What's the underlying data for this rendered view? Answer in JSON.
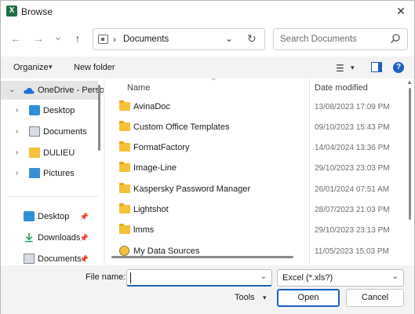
{
  "window": {
    "title": "Browse",
    "app_icon_glyph": "X",
    "close_glyph": "✕"
  },
  "nav": {
    "back_glyph": "←",
    "forward_glyph": "→",
    "recent_glyph": "⌄",
    "up_glyph": "↑",
    "address_sep": "›",
    "address": "Documents",
    "address_drop_glyph": "⌄",
    "refresh_glyph": "↻",
    "search_placeholder": "Search Documents"
  },
  "toolbar": {
    "organize": "Organize",
    "organize_caret": "▾",
    "new_folder": "New folder",
    "view_glyph": "☰",
    "view_caret": "▾",
    "help_glyph": "?"
  },
  "navpane": {
    "items": [
      {
        "label": "OneDrive - Perso",
        "chev": "⌄",
        "icon": "cloud-icon",
        "selected": true
      },
      {
        "label": "Desktop",
        "chev": "›",
        "icon": "desktop-icon"
      },
      {
        "label": "Documents",
        "chev": "›",
        "icon": "documents-icon"
      },
      {
        "label": "DULIEU",
        "chev": "›",
        "icon": "folder-icon"
      },
      {
        "label": "Pictures",
        "chev": "›",
        "icon": "pictures-icon"
      }
    ],
    "quick": [
      {
        "label": "Desktop",
        "icon": "desktop-icon",
        "pin": "📌"
      },
      {
        "label": "Downloads",
        "icon": "download-icon",
        "pin": "📌"
      },
      {
        "label": "Documents",
        "icon": "documents-icon",
        "pin": "📌"
      }
    ]
  },
  "filelist": {
    "columns": {
      "name": "Name",
      "date": "Date modified"
    },
    "sort_glyph": "^",
    "rows": [
      {
        "name": "AvinaDoc",
        "date": "13/08/2023 17:09 PM"
      },
      {
        "name": "Custom Office Templates",
        "date": "09/10/2023 15:43 PM"
      },
      {
        "name": "FormatFactory",
        "date": "14/04/2024 13:36 PM"
      },
      {
        "name": "Image-Line",
        "date": "29/10/2023 23:03 PM"
      },
      {
        "name": "Kaspersky Password Manager",
        "date": "26/01/2024 07:51 AM"
      },
      {
        "name": "Lightshot",
        "date": "28/07/2023 21:03 PM"
      },
      {
        "name": "lmms",
        "date": "29/10/2023 23:13 PM"
      },
      {
        "name": "My Data Sources",
        "date": "11/05/2023 15:03 PM"
      }
    ]
  },
  "bottom": {
    "file_name_label": "File name:",
    "file_name_value": "",
    "drop_glyph": "⌄",
    "filter": "Excel (*.xls?)",
    "tools": "Tools",
    "tools_caret": "▾",
    "open": "Open",
    "cancel": "Cancel"
  },
  "colors": {
    "accent": "#1f5fbf",
    "folder": "#f3c13a",
    "excel": "#1d7044"
  }
}
